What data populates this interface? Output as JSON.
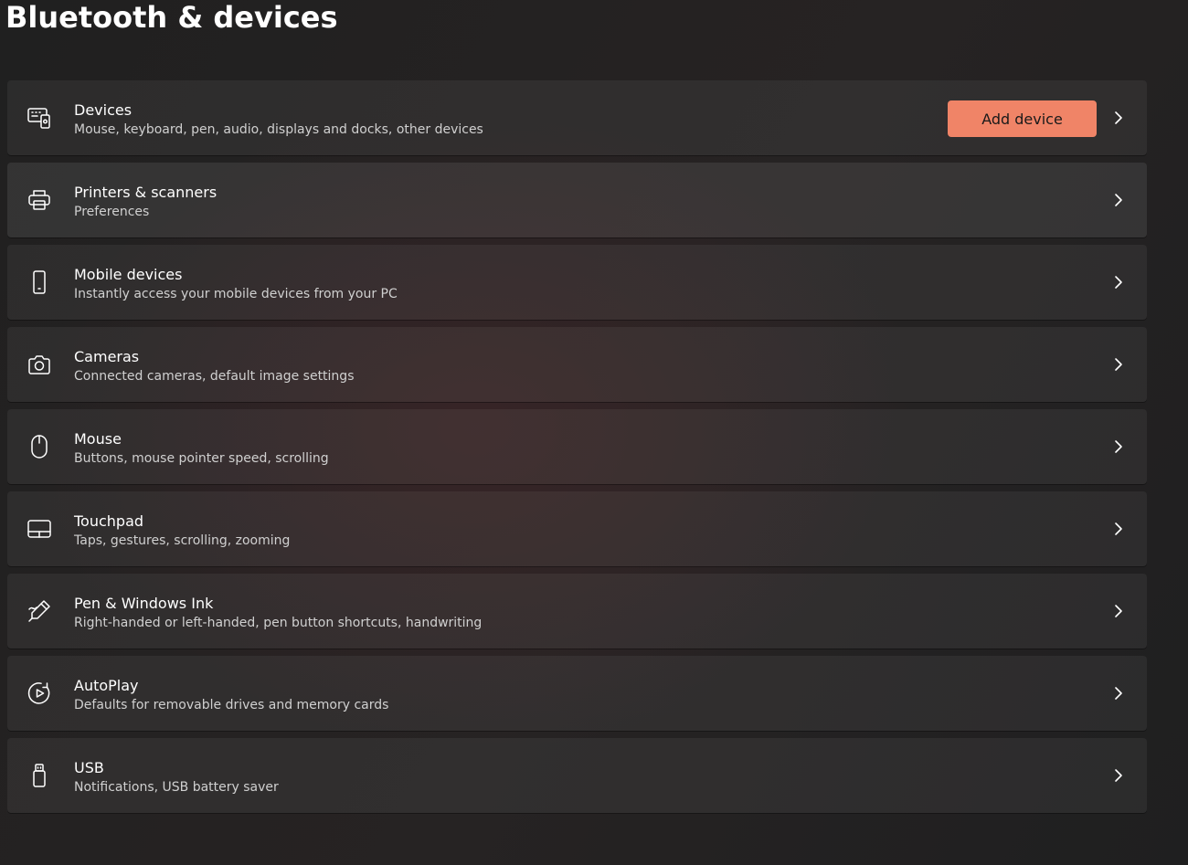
{
  "page": {
    "title": "Bluetooth & devices"
  },
  "accent_color": "#f08467",
  "items": [
    {
      "icon": "devices-icon",
      "title": "Devices",
      "subtitle": "Mouse, keyboard, pen, audio, displays and docks, other devices",
      "button_label": "Add device"
    },
    {
      "icon": "printer-icon",
      "title": "Printers & scanners",
      "subtitle": "Preferences"
    },
    {
      "icon": "phone-icon",
      "title": "Mobile devices",
      "subtitle": "Instantly access your mobile devices from your PC"
    },
    {
      "icon": "camera-icon",
      "title": "Cameras",
      "subtitle": "Connected cameras, default image settings"
    },
    {
      "icon": "mouse-icon",
      "title": "Mouse",
      "subtitle": "Buttons, mouse pointer speed, scrolling"
    },
    {
      "icon": "touchpad-icon",
      "title": "Touchpad",
      "subtitle": "Taps, gestures, scrolling, zooming"
    },
    {
      "icon": "pen-icon",
      "title": "Pen & Windows Ink",
      "subtitle": "Right-handed or left-handed, pen button shortcuts, handwriting"
    },
    {
      "icon": "autoplay-icon",
      "title": "AutoPlay",
      "subtitle": "Defaults for removable drives and memory cards"
    },
    {
      "icon": "usb-icon",
      "title": "USB",
      "subtitle": "Notifications, USB battery saver"
    }
  ]
}
